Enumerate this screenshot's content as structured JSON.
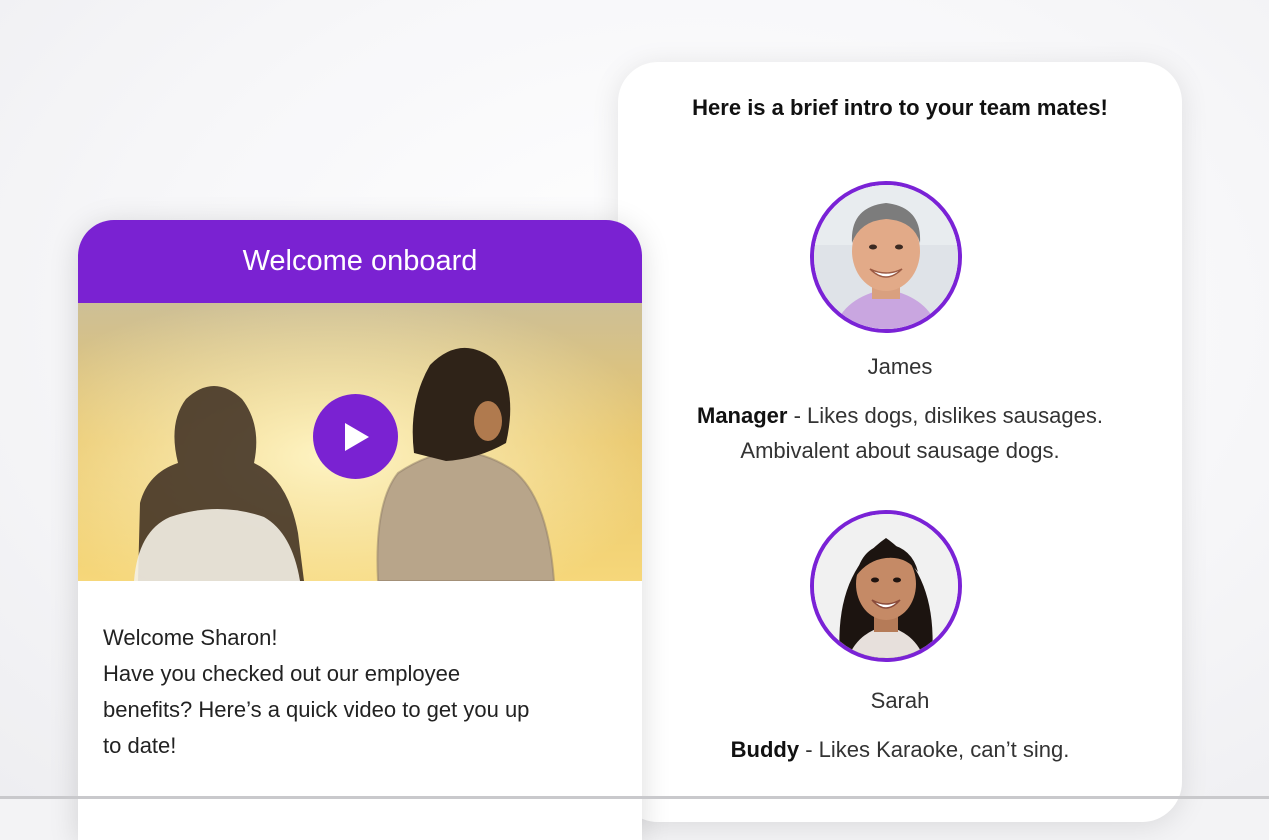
{
  "welcome_card": {
    "header": "Welcome onboard",
    "play_icon": "play-icon",
    "message_lines": [
      "Welcome Sharon!",
      "Have you checked out our employee",
      "benefits? Here’s a quick video to get you up",
      "to date!"
    ]
  },
  "team_card": {
    "title": "Here is a brief intro to your team mates!",
    "members": [
      {
        "name": "James",
        "role": "Manager",
        "desc_line1": " - Likes dogs, dislikes sausages.",
        "desc_line2": "Ambivalent about sausage dogs."
      },
      {
        "name": "Sarah",
        "role": "Buddy",
        "desc_line1": " - Likes Karaoke, can’t sing."
      }
    ]
  },
  "colors": {
    "accent": "#7a22d2",
    "text": "#333333"
  }
}
